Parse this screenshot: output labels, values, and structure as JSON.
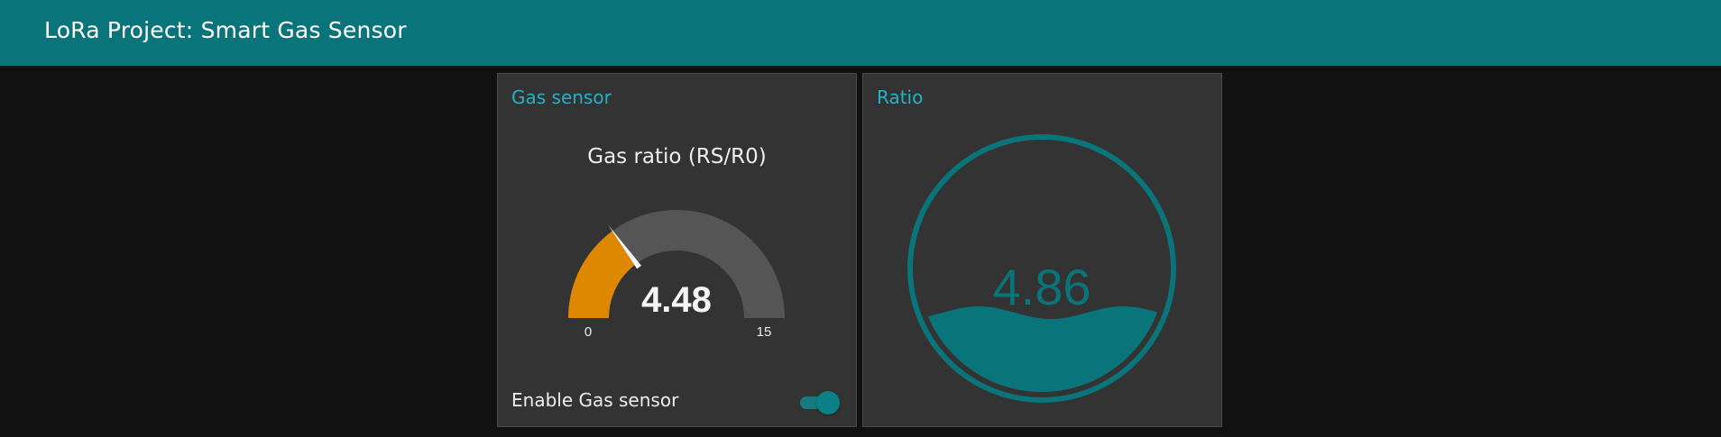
{
  "app": {
    "title": "LoRa Project: Smart Gas Sensor"
  },
  "colors": {
    "header": "#097479",
    "background": "#111111",
    "card": "#333333",
    "accent": "#22b3c4",
    "gauge_fill": "#dd8800",
    "gauge_track": "#555555",
    "liquid": "#097479"
  },
  "gas_card": {
    "title": "Gas sensor",
    "gauge": {
      "title": "Gas ratio (RS/R0)",
      "value": 4.48,
      "value_text": "4.48",
      "min": 0,
      "max": 15,
      "min_label": "0",
      "max_label": "15"
    },
    "toggle": {
      "label": "Enable Gas sensor",
      "checked": true
    }
  },
  "ratio_card": {
    "title": "Ratio",
    "liquid": {
      "value": 4.86,
      "value_text": "4.86"
    }
  }
}
